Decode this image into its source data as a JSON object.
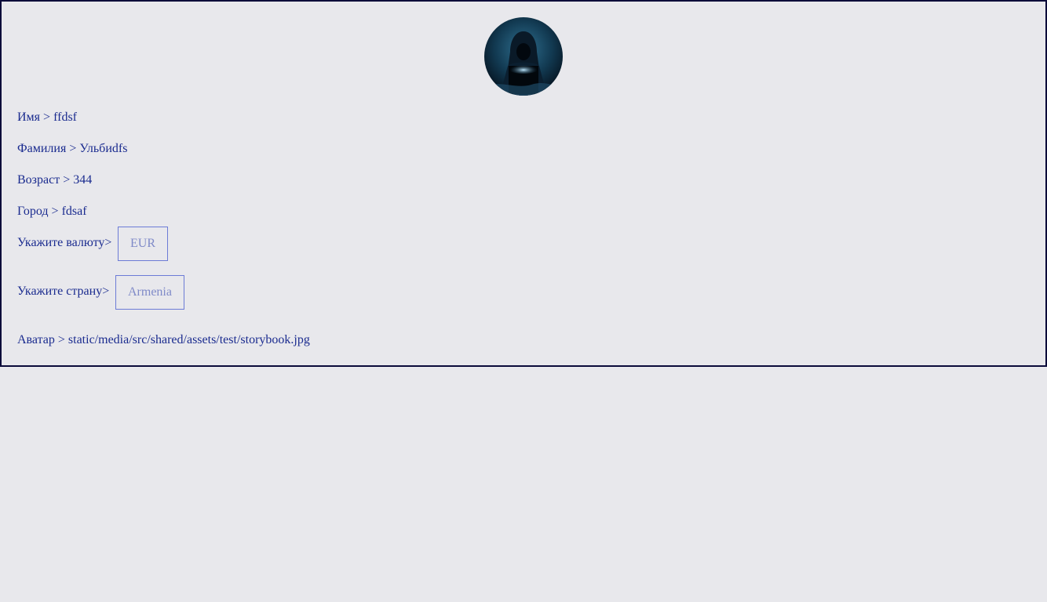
{
  "profile": {
    "avatar_icon": "hooded-hacker-avatar",
    "first_name": {
      "label": "Имя",
      "sep": ">",
      "value": "ffdsf"
    },
    "last_name": {
      "label": "Фамилия",
      "sep": ">",
      "value": "Ульбиdfs"
    },
    "age": {
      "label": "Возраст",
      "sep": ">",
      "value": "344"
    },
    "city": {
      "label": "Город",
      "sep": ">",
      "value": "fdsaf"
    },
    "currency": {
      "label": "Укажите валюту>",
      "value": "EUR"
    },
    "country": {
      "label": "Укажите страну>",
      "value": "Armenia"
    },
    "avatar_path": {
      "label": "Аватар",
      "sep": ">",
      "value": "static/media/src/shared/assets/test/storybook.jpg"
    }
  },
  "colors": {
    "text": "#1a2b8f",
    "border": "#0b0b3a",
    "select_border": "#6c7bd6",
    "background": "#e8e8ec"
  }
}
